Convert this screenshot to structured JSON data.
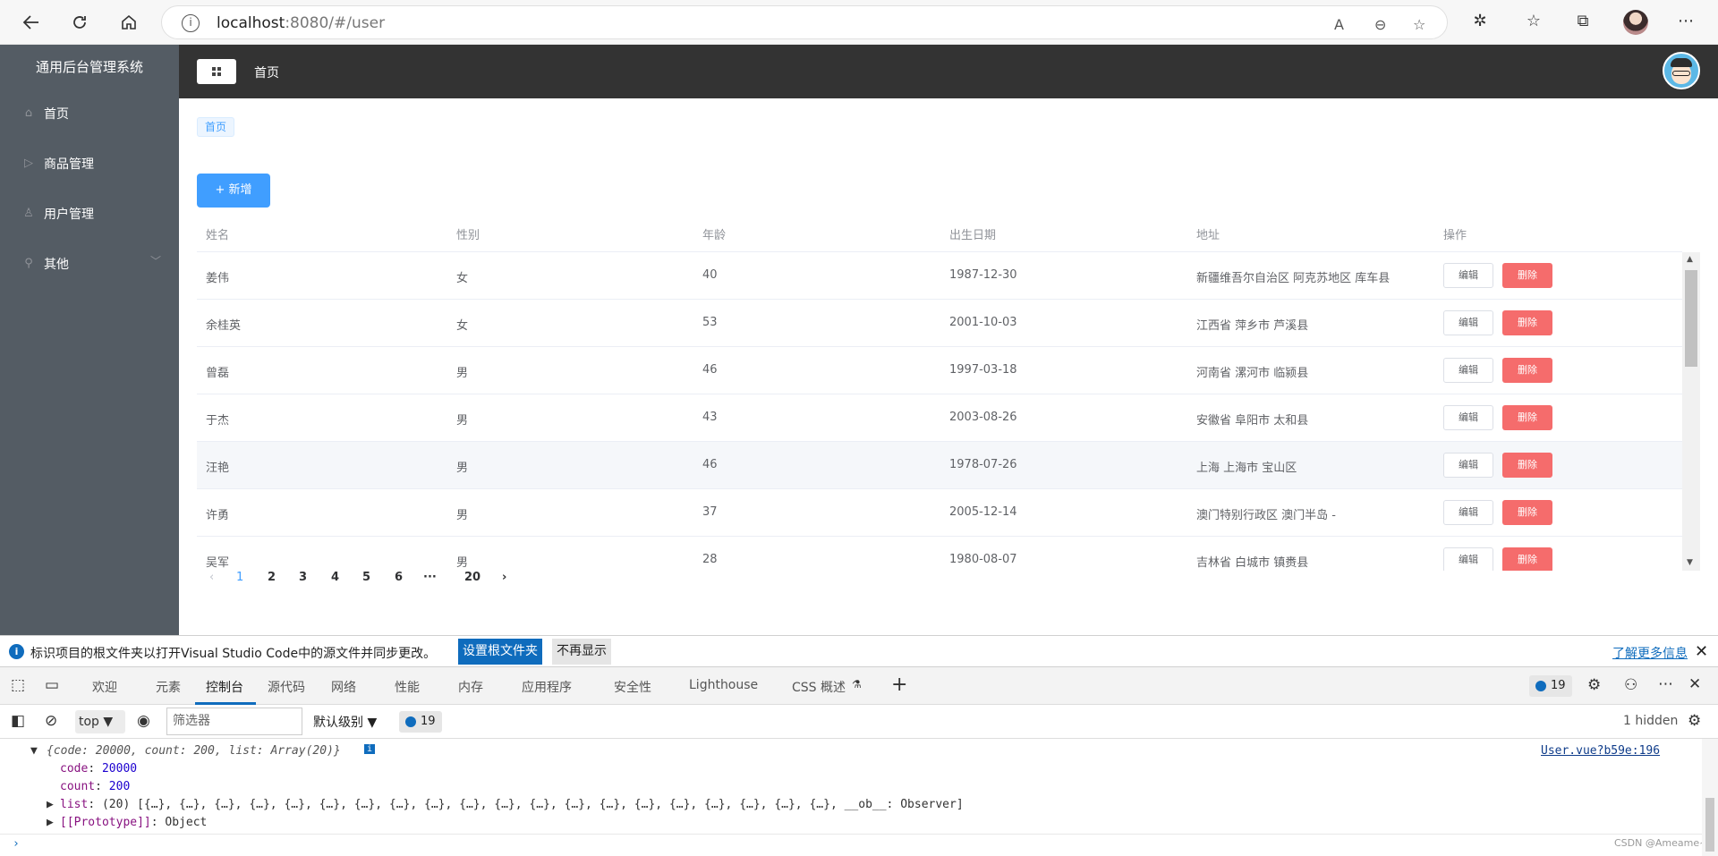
{
  "browser": {
    "url_host": "localhost",
    "url_rest": ":8080/#/user",
    "info_icon": "i"
  },
  "app": {
    "title": "通用后台管理系统",
    "menu": [
      {
        "label": "首页",
        "icon": "home-icon"
      },
      {
        "label": "商品管理",
        "icon": "video-play-icon"
      },
      {
        "label": "用户管理",
        "icon": "user-icon"
      },
      {
        "label": "其他",
        "icon": "location-icon"
      }
    ],
    "header_home": "首页",
    "breadcrumb_tag": "首页",
    "add_button": "+ 新增"
  },
  "table": {
    "columns": [
      "姓名",
      "性别",
      "年龄",
      "出生日期",
      "地址",
      "操作"
    ],
    "rows": [
      {
        "name": "姜伟",
        "sex": "女",
        "age": "40",
        "birth": "1987-12-30",
        "addr": "新疆维吾尔自治区 阿克苏地区 库车县"
      },
      {
        "name": "余桂英",
        "sex": "女",
        "age": "53",
        "birth": "2001-10-03",
        "addr": "江西省 萍乡市 芦溪县"
      },
      {
        "name": "曾磊",
        "sex": "男",
        "age": "46",
        "birth": "1997-03-18",
        "addr": "河南省 漯河市 临颍县"
      },
      {
        "name": "于杰",
        "sex": "男",
        "age": "43",
        "birth": "2003-08-26",
        "addr": "安徽省 阜阳市 太和县"
      },
      {
        "name": "汪艳",
        "sex": "男",
        "age": "46",
        "birth": "1978-07-26",
        "addr": "上海 上海市 宝山区"
      },
      {
        "name": "许勇",
        "sex": "男",
        "age": "37",
        "birth": "2005-12-14",
        "addr": "澳门特别行政区 澳门半岛 -"
      },
      {
        "name": "吴军",
        "sex": "男",
        "age": "28",
        "birth": "1980-08-07",
        "addr": "吉林省 白城市 镇赉县"
      }
    ],
    "edit_label": "编辑",
    "delete_label": "删除"
  },
  "pager": {
    "prev": "‹",
    "pages": [
      "1",
      "2",
      "3",
      "4",
      "5",
      "6",
      "···",
      "20"
    ],
    "next": "›",
    "active": "1"
  },
  "infobar": {
    "message": "标识项目的根文件夹以打开Visual Studio Code中的源文件并同步更改。",
    "set_root": "设置根文件夹",
    "dont_show": "不再显示",
    "learn_more": "了解更多信息"
  },
  "devtools": {
    "tabs": [
      "欢迎",
      "元素",
      "控制台",
      "源代码",
      "网络",
      "性能",
      "内存",
      "应用程序",
      "安全性",
      "Lighthouse",
      "CSS 概述"
    ],
    "active_tab": "控制台",
    "issues_count": "19",
    "context": "top",
    "filter_placeholder": "筛选器",
    "level": "默认级别",
    "hidden": "1 hidden",
    "source_link": "User.vue?b59e:196",
    "log_header": "{code: 20000, count: 200, list: Array(20)}",
    "code_line_key": "code",
    "code_line_val": "20000",
    "count_line_key": "count",
    "count_line_val": "200",
    "list_line_key": "list",
    "list_line_val": "(20) [{…}, {…}, {…}, {…}, {…}, {…}, {…}, {…}, {…}, {…}, {…}, {…}, {…}, {…}, {…}, {…}, {…}, {…}, {…}, {…}, __ob__: Observer]",
    "proto_line_key": "[[Prototype]]",
    "proto_line_val": "Object",
    "watermark": "CSDN @Ameame~"
  }
}
